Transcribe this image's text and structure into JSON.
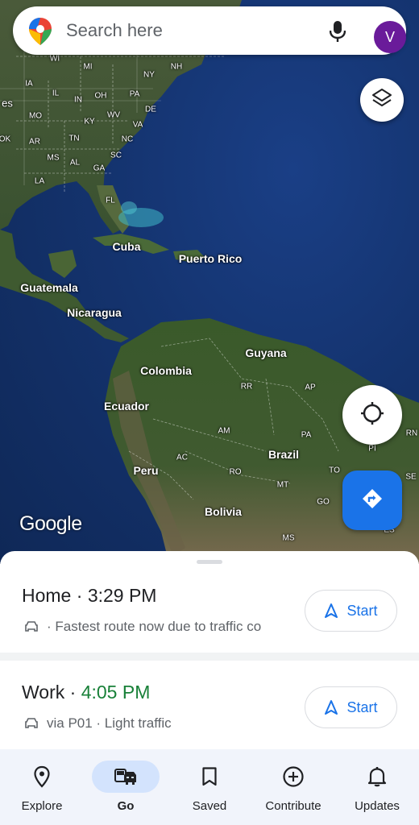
{
  "search": {
    "placeholder": "Search here",
    "avatar_letter": "V"
  },
  "map": {
    "attribution": "Google",
    "labels": {
      "wi": "WI",
      "mi": "MI",
      "ny": "NY",
      "nh": "NH",
      "ia": "IA",
      "il": "IL",
      "in": "IN",
      "oh": "OH",
      "pa": "PA",
      "es": "es",
      "mo": "MO",
      "wv": "WV",
      "de": "DE",
      "ky": "KY",
      "va": "VA",
      "ok": "OK",
      "ar": "AR",
      "tn": "TN",
      "nc": "NC",
      "ms": "MS",
      "al": "AL",
      "sc": "SC",
      "ga": "GA",
      "la": "LA",
      "fl": "FL",
      "cuba": "Cuba",
      "puerto_rico": "Puerto Rico",
      "guatemala": "Guatemala",
      "nicaragua": "Nicaragua",
      "guyana": "Guyana",
      "colombia": "Colombia",
      "rr": "RR",
      "ap": "AP",
      "ecuador": "Ecuador",
      "am": "AM",
      "pa_br": "PA",
      "ac": "AC",
      "brazil": "Brazil",
      "pi": "PI",
      "rn": "RN",
      "ro": "RO",
      "to": "TO",
      "peru": "Peru",
      "mt": "MT",
      "se": "SE",
      "go": "GO",
      "bolivia": "Bolivia",
      "ms_br": "MS",
      "es_br": "ES"
    }
  },
  "routes": [
    {
      "place": "Home",
      "separator": " · ",
      "time": "3:29 PM",
      "time_color": "#202124",
      "detail": "· Fastest route now due to traffic co",
      "action": "Start"
    },
    {
      "place": "Work",
      "separator": " · ",
      "time": "4:05 PM",
      "time_color": "#188038",
      "detail": "via P01 · Light traffic",
      "action": "Start"
    }
  ],
  "nav": {
    "items": [
      {
        "label": "Explore",
        "icon": "pin-icon",
        "active": false
      },
      {
        "label": "Go",
        "icon": "car-icon",
        "active": true
      },
      {
        "label": "Saved",
        "icon": "bookmark-icon",
        "active": false
      },
      {
        "label": "Contribute",
        "icon": "add-circle-icon",
        "active": false
      },
      {
        "label": "Updates",
        "icon": "bell-icon",
        "active": false
      }
    ]
  },
  "colors": {
    "accent": "#1a73e8",
    "avatar": "#6a1b9a",
    "traffic_green": "#188038",
    "nav_active": "#d3e3fd"
  }
}
